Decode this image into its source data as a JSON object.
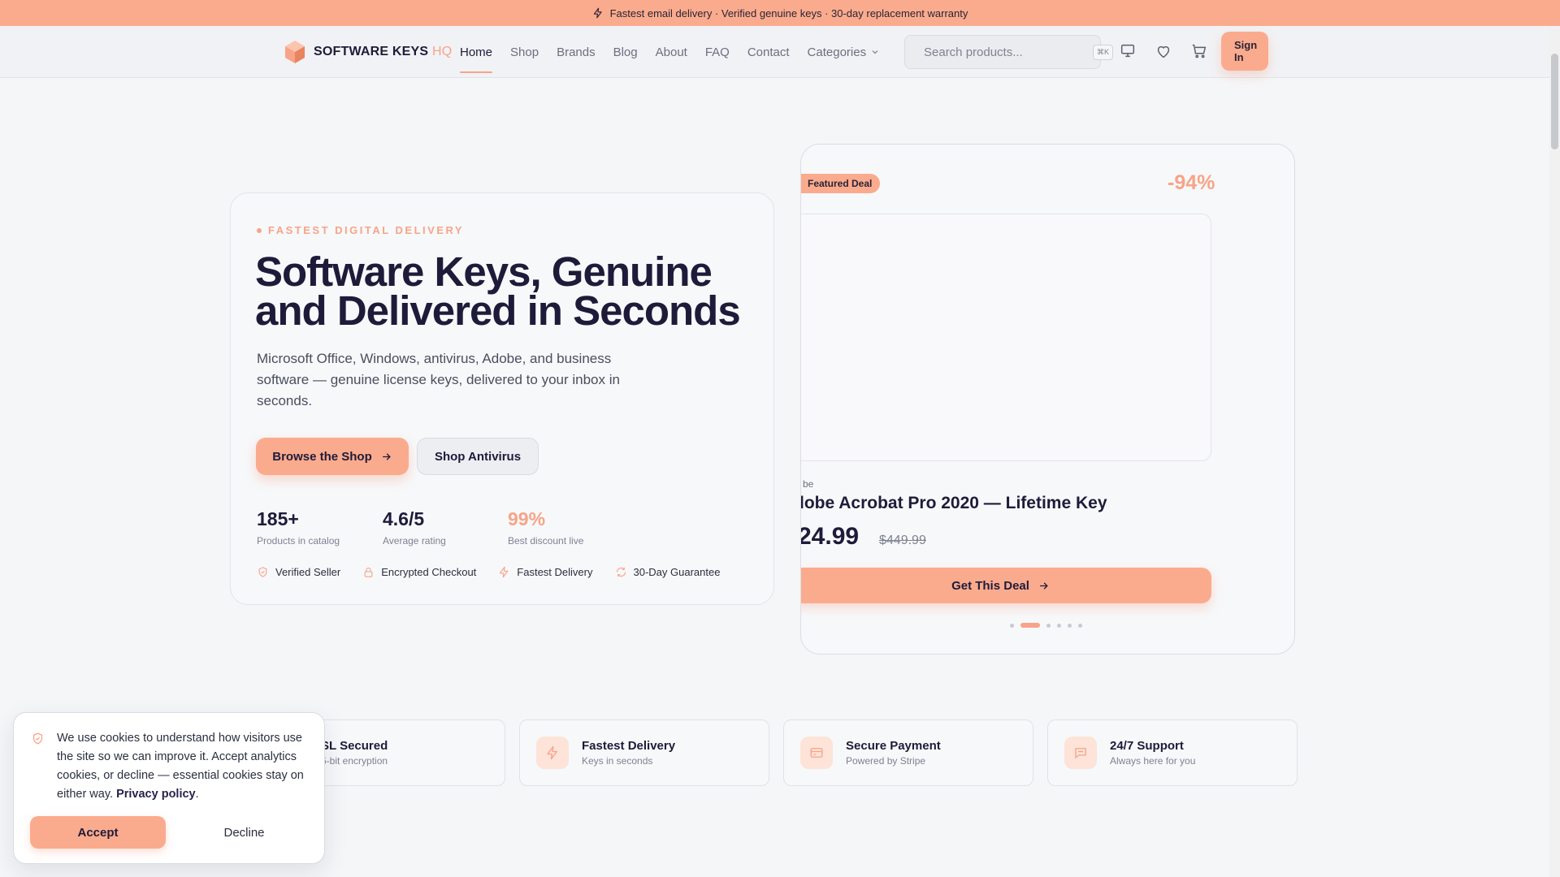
{
  "announcement": {
    "text": "Fastest email delivery · Verified genuine keys · 30-day replacement warranty"
  },
  "header": {
    "logo_text": "SOFTWARE KEYS",
    "logo_suffix": "HQ",
    "nav": [
      {
        "label": "Home",
        "active": true
      },
      {
        "label": "Shop"
      },
      {
        "label": "Brands"
      },
      {
        "label": "Blog"
      },
      {
        "label": "About"
      },
      {
        "label": "FAQ"
      },
      {
        "label": "Contact"
      },
      {
        "label": "Categories"
      }
    ],
    "search_placeholder": "Search products...",
    "search_shortcut": "⌘K",
    "sign_in_line1": "Sign",
    "sign_in_line2": "In"
  },
  "hero": {
    "eyebrow": "FASTEST DIGITAL DELIVERY",
    "title_line1": "Software Keys, Genuine",
    "title_line2": "and Delivered in Seconds",
    "subtitle": "Microsoft Office, Windows, antivirus, Adobe, and business software — genuine license keys, delivered to your inbox in seconds.",
    "primary_cta": "Browse the Shop",
    "secondary_cta": "Shop Antivirus",
    "stats": [
      {
        "value": "185+",
        "label": "Products in catalog"
      },
      {
        "value": "4.6/5",
        "label": "Average rating"
      },
      {
        "value": "99%",
        "label": "Best discount live"
      }
    ],
    "trust": [
      {
        "label": "Verified Seller",
        "icon": "shield-icon"
      },
      {
        "label": "Encrypted Checkout",
        "icon": "lock-icon"
      },
      {
        "label": "Fastest Delivery",
        "icon": "bolt-icon"
      },
      {
        "label": "30-Day Guarantee",
        "icon": "refresh-icon"
      }
    ]
  },
  "deal": {
    "badge": "Featured Deal",
    "discount": "-94%",
    "brand": "be",
    "title": "lobe Acrobat Pro 2020 — Lifetime Key",
    "price": "24.99",
    "old_price": "$449.99",
    "cta": "Get This Deal",
    "carousel_count": 6,
    "carousel_active": 2
  },
  "features": [
    {
      "title": "SL Secured",
      "subtitle": "6-bit encryption",
      "icon": "lock-icon"
    },
    {
      "title": "Fastest Delivery",
      "subtitle": "Keys in seconds",
      "icon": "bolt-icon"
    },
    {
      "title": "Secure Payment",
      "subtitle": "Powered by Stripe",
      "icon": "credit-card-icon"
    },
    {
      "title": "24/7 Support",
      "subtitle": "Always here for you",
      "icon": "chat-icon"
    }
  ],
  "cookie": {
    "text": "We use cookies to understand how visitors use the site so we can improve it. Accept analytics cookies, or decline — essential cookies stay on either way.",
    "link": "Privacy policy",
    "accept": "Accept",
    "decline": "Decline"
  },
  "colors": {
    "accent": "#fbab8d",
    "accent_text": "#f7a488",
    "ink": "#1e1b3a",
    "background": "#f5f6f8"
  }
}
